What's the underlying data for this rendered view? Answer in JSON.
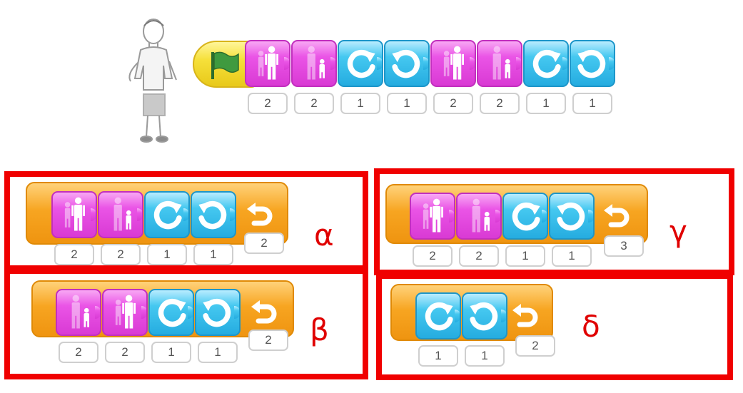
{
  "main_script": {
    "start_block": "green-flag",
    "blocks": [
      {
        "icon": "grow-icon",
        "color": "pink",
        "value": "2"
      },
      {
        "icon": "shrink-icon",
        "color": "pink",
        "value": "2"
      },
      {
        "icon": "turn-right-icon",
        "color": "blue",
        "value": "1"
      },
      {
        "icon": "turn-left-icon",
        "color": "blue",
        "value": "1"
      },
      {
        "icon": "grow-icon",
        "color": "pink",
        "value": "2"
      },
      {
        "icon": "shrink-icon",
        "color": "pink",
        "value": "2"
      },
      {
        "icon": "turn-right-icon",
        "color": "blue",
        "value": "1"
      },
      {
        "icon": "turn-left-icon",
        "color": "blue",
        "value": "1"
      }
    ]
  },
  "options": [
    {
      "label": "α",
      "blocks": [
        {
          "icon": "grow-icon",
          "value": "2"
        },
        {
          "icon": "shrink-icon",
          "value": "2"
        },
        {
          "icon": "turn-right-icon",
          "value": "1"
        },
        {
          "icon": "turn-left-icon",
          "value": "1"
        }
      ],
      "repeat": "2"
    },
    {
      "label": "β",
      "blocks": [
        {
          "icon": "shrink-icon",
          "value": "2"
        },
        {
          "icon": "grow-icon",
          "value": "2"
        },
        {
          "icon": "turn-right-icon",
          "value": "1"
        },
        {
          "icon": "turn-left-icon",
          "value": "1"
        }
      ],
      "repeat": "2"
    },
    {
      "label": "γ",
      "blocks": [
        {
          "icon": "grow-icon",
          "value": "2"
        },
        {
          "icon": "shrink-icon",
          "value": "2"
        },
        {
          "icon": "turn-right-icon",
          "value": "1"
        },
        {
          "icon": "turn-left-icon",
          "value": "1"
        }
      ],
      "repeat": "3"
    },
    {
      "label": "δ",
      "blocks": [
        {
          "icon": "turn-right-icon",
          "value": "1"
        },
        {
          "icon": "turn-left-icon",
          "value": "1"
        }
      ],
      "repeat": "2"
    }
  ],
  "colors": {
    "frame": "#f00000",
    "pink": "#e84fe3",
    "blue": "#3fc2ee",
    "orange": "#f7a521",
    "yellow": "#f5dd37",
    "flag": "#3a8f3a"
  }
}
